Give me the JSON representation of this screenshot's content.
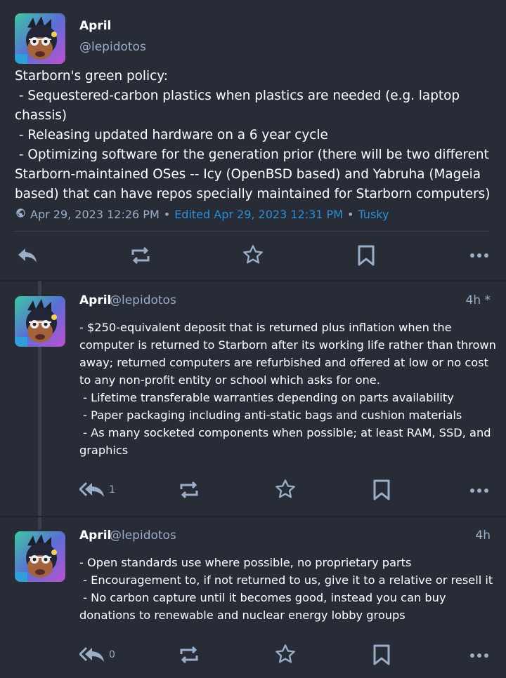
{
  "main_status": {
    "author_name": "April",
    "author_handle": "@lepidotos",
    "content": "Starborn's green policy:\n - Sequestered-carbon plastics when plastics are needed (e.g. laptop chassis)\n - Releasing updated hardware on a 6 year cycle\n - Optimizing software for the generation prior (there will be two different Starborn-maintained OSes -- Icy (OpenBSD based) and Yabruha (Mageia based) that can have repos specially maintained for Starborn computers)",
    "timestamp": "Apr 29, 2023 12:26 PM",
    "separator": "•",
    "edited": "Edited Apr 29, 2023 12:31 PM",
    "application": "Tusky"
  },
  "replies": [
    {
      "author_name": "April",
      "author_handle": "@lepidotos",
      "time": "4h *",
      "content": "- $250-equivalent deposit that is returned plus inflation when the computer is returned to Starborn after its working life rather than thrown away; returned computers are refurbished and offered at low or no cost to any non-profit entity or school which asks for one.\n - Lifetime transferable warranties depending on parts availability\n - Paper packaging including anti-static bags and cushion materials\n - As many socketed components when possible; at least RAM, SSD, and graphics",
      "reply_count": "1"
    },
    {
      "author_name": "April",
      "author_handle": "@lepidotos",
      "time": "4h",
      "content": "- Open standards use where possible, no proprietary parts\n - Encouragement to, if not returned to us, give it to a relative or resell it\n - No carbon capture until it becomes good, instead you can buy donations to renewable and nuclear energy lobby groups",
      "reply_count": "0"
    }
  ],
  "icons": {
    "reply": "reply-icon",
    "reply_all": "reply-all-icon",
    "boost": "boost-icon",
    "favourite": "star-icon",
    "bookmark": "bookmark-icon",
    "more": "more-icon",
    "visibility": "globe-icon"
  },
  "colors": {
    "background": "#282c37",
    "secondary_text": "#9baec8",
    "link": "#2b90d9",
    "icon": "#9baec8"
  }
}
